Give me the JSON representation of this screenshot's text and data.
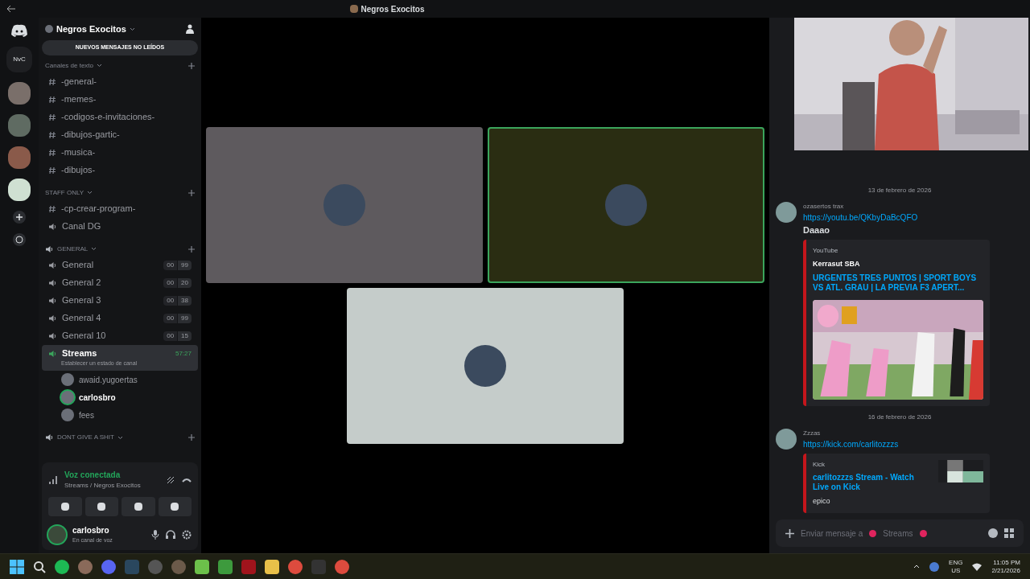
{
  "window": {
    "title": "Negros Exocitos"
  },
  "server": {
    "name": "Negros Exocitos",
    "unread_banner": "NUEVOS MENSAJES NO LEÍDOS"
  },
  "rail": {
    "label": "NvC"
  },
  "categories": [
    {
      "name": "Canales de texto",
      "channels": [
        {
          "kind": "text",
          "name": "-general-",
          "selected": false
        },
        {
          "kind": "text",
          "name": "-memes-",
          "selected": false
        },
        {
          "kind": "text",
          "name": "-codigos-e-invitaciones-",
          "selected": false
        },
        {
          "kind": "text",
          "name": "-dibujos-gartic-",
          "selected": false
        },
        {
          "kind": "text",
          "name": "-musica-",
          "selected": false
        },
        {
          "kind": "text",
          "name": "-dibujos-",
          "selected": false
        }
      ]
    },
    {
      "name": "STAFF ONLY",
      "channels": [
        {
          "kind": "text",
          "name": "-cp-crear-program-",
          "selected": false
        },
        {
          "kind": "voice",
          "name": "Canal DG",
          "selected": false
        }
      ]
    },
    {
      "name": "GENERAL",
      "channels": [
        {
          "kind": "voice",
          "name": "General",
          "selected": false,
          "count": "00",
          "limit": "99"
        },
        {
          "kind": "voice",
          "name": "General 2",
          "selected": false,
          "count": "00",
          "limit": "20"
        },
        {
          "kind": "voice",
          "name": "General 3",
          "selected": false,
          "count": "00",
          "limit": "38"
        },
        {
          "kind": "voice",
          "name": "General 4",
          "selected": false,
          "count": "00",
          "limit": "99"
        },
        {
          "kind": "voice",
          "name": "General 10",
          "selected": false,
          "count": "00",
          "limit": "15"
        },
        {
          "kind": "voice",
          "name": "Streams",
          "selected": true,
          "time": "57:27",
          "status": "Establecer un estado de canal",
          "members": [
            {
              "name": "awaid.yugoertas",
              "speaking": false
            },
            {
              "name": "carlosbro",
              "speaking": true
            },
            {
              "name": "fees",
              "speaking": false
            }
          ]
        }
      ]
    },
    {
      "name": "DONT GIVE A SHIT"
    }
  ],
  "voice_panel": {
    "status": "Voz conectada",
    "location": "Streams / Negros Exocitos"
  },
  "user": {
    "name": "carlosbro",
    "status": "En canal de voz"
  },
  "tiles": [
    {
      "color": "#5e5a5e",
      "speaking": false
    },
    {
      "color": "#2a2d12",
      "speaking": true
    },
    {
      "color": "#c5ccca",
      "speaking": false
    }
  ],
  "chat": {
    "messages": [
      {
        "date": "13 de febrero de 2026",
        "author": "ozasertos trax",
        "link": "https://youtu.be/QKbyDaBcQFO",
        "text": "Daaao",
        "embed": {
          "provider": "YouTube",
          "author": "Kerrasut SBA",
          "title": "URGENTES TRES PUNTOS | SPORT BOYS VS ATL. GRAU | LA PREVIA F3 APERT...",
          "kind": "video"
        }
      },
      {
        "date": "16 de febrero de 2026",
        "author": "Zzzas",
        "link": "https://kick.com/carlitozzzs",
        "embed": {
          "provider": "Kick",
          "title": "carlitozzzs Stream - Watch Live on Kick",
          "description": "epico",
          "kind": "link"
        }
      }
    ],
    "input": {
      "placeholder": "Enviar mensaje a",
      "channel": "Streams"
    }
  },
  "taskbar": {
    "lang": "ENG",
    "region": "US",
    "time": "11:05 PM",
    "date": "2/21/2026"
  }
}
